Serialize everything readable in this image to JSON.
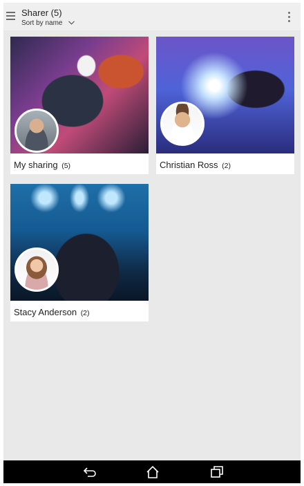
{
  "header": {
    "title": "Sharer (5)",
    "sort_label": "Sort by name",
    "menu_icon": "hamburger-menu-icon",
    "more_icon": "more-vertical-icon"
  },
  "cards": [
    {
      "name": "My sharing",
      "count": "(5)"
    },
    {
      "name": "Christian Ross",
      "count": "(2)"
    },
    {
      "name": "Stacy Anderson",
      "count": "(2)"
    }
  ],
  "navbar": {
    "back_icon": "back-icon",
    "home_icon": "home-icon",
    "recent_icon": "recent-apps-icon"
  },
  "colors": {
    "background": "#e9e9e9",
    "card": "#ffffff",
    "navbar": "#000000",
    "icon": "#6c6c6c"
  }
}
